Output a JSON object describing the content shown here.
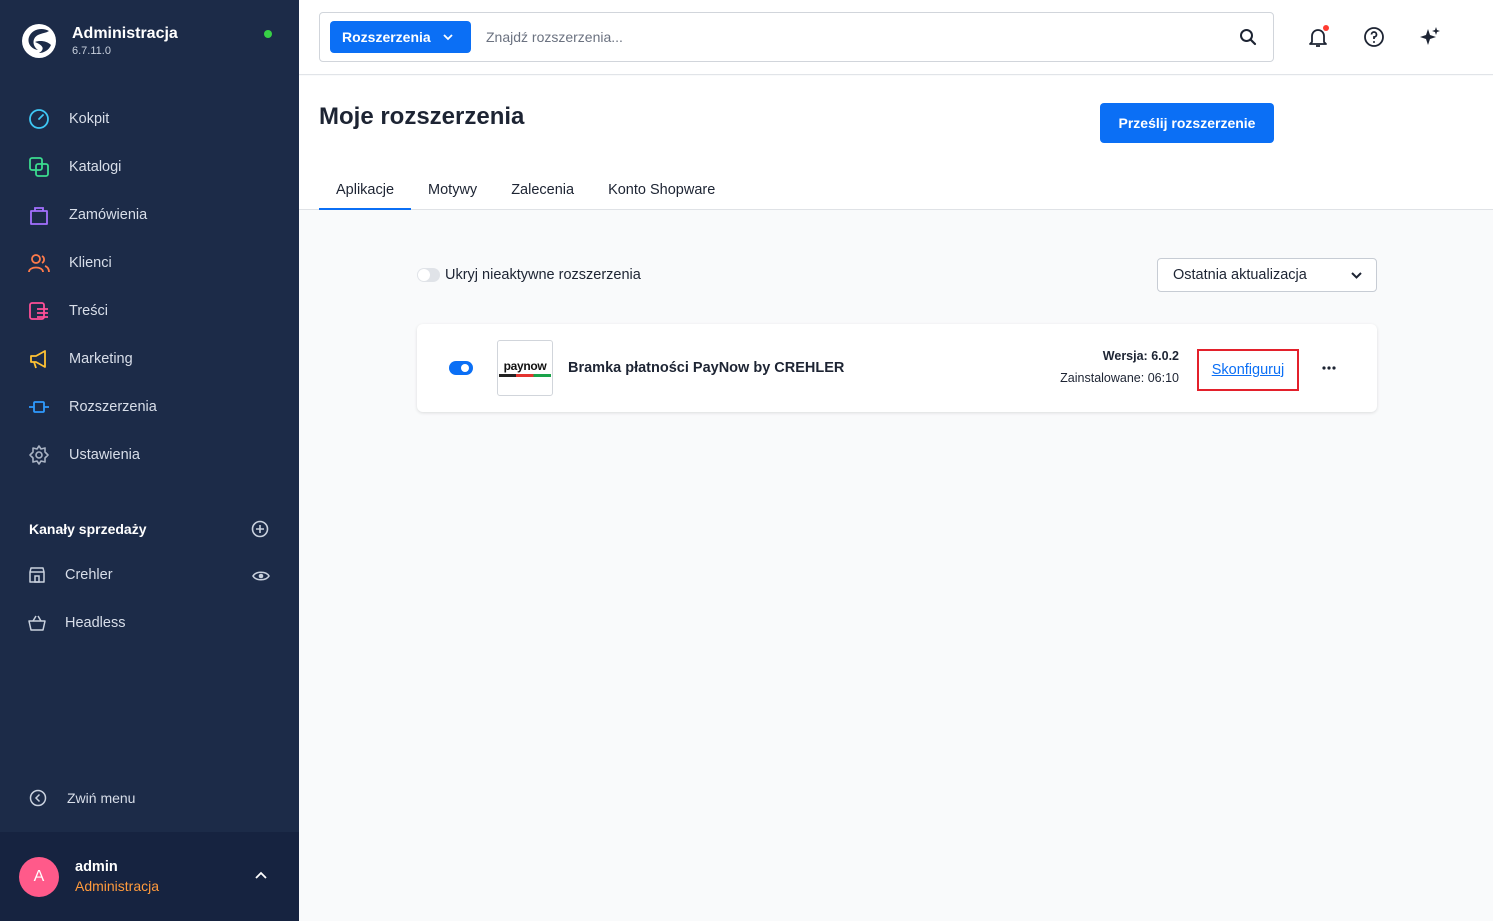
{
  "brand": {
    "title": "Administracja",
    "version": "6.7.11.0"
  },
  "nav": [
    {
      "label": "Kokpit",
      "icon": "dashboard-icon",
      "color": "#3ec7f4"
    },
    {
      "label": "Katalogi",
      "icon": "catalog-icon",
      "color": "#3bdc8f"
    },
    {
      "label": "Zamówienia",
      "icon": "orders-icon",
      "color": "#a470ff"
    },
    {
      "label": "Klienci",
      "icon": "customers-icon",
      "color": "#ff7b4a"
    },
    {
      "label": "Treści",
      "icon": "content-icon",
      "color": "#ff4f97"
    },
    {
      "label": "Marketing",
      "icon": "marketing-icon",
      "color": "#ffc233"
    },
    {
      "label": "Rozszerzenia",
      "icon": "extensions-icon",
      "color": "#2f9bff"
    },
    {
      "label": "Ustawienia",
      "icon": "settings-icon",
      "color": "#a9b3c4"
    }
  ],
  "sales_channels": {
    "title": "Kanały sprzedaży",
    "items": [
      {
        "label": "Crehler",
        "icon": "storefront-icon"
      },
      {
        "label": "Headless",
        "icon": "basket-icon"
      }
    ]
  },
  "collapse_label": "Zwiń menu",
  "user": {
    "initial": "A",
    "name": "admin",
    "role": "Administracja"
  },
  "search": {
    "scope": "Rozszerzenia",
    "placeholder": "Znajdź rozszerzenia..."
  },
  "page": {
    "title": "Moje rozszerzenia",
    "upload_label": "Prześlij rozszerzenie",
    "tabs": [
      "Aplikacje",
      "Motywy",
      "Zalecenia",
      "Konto Shopware"
    ],
    "active_tab": 0
  },
  "filter": {
    "hide_inactive_label": "Ukryj nieaktywne rozszerzenia",
    "sort_label": "Ostatnia aktualizacja"
  },
  "extension": {
    "logo_text": "paynow",
    "name": "Bramka płatności PayNow by CREHLER",
    "version": "Wersja: 6.0.2",
    "installed": "Zainstalowane: 06:10",
    "configure_label": "Skonfiguruj",
    "active": true
  },
  "colors": {
    "accent": "#0b6ff5",
    "sidebar": "#1c2b48",
    "highlight": "#e3202b"
  }
}
